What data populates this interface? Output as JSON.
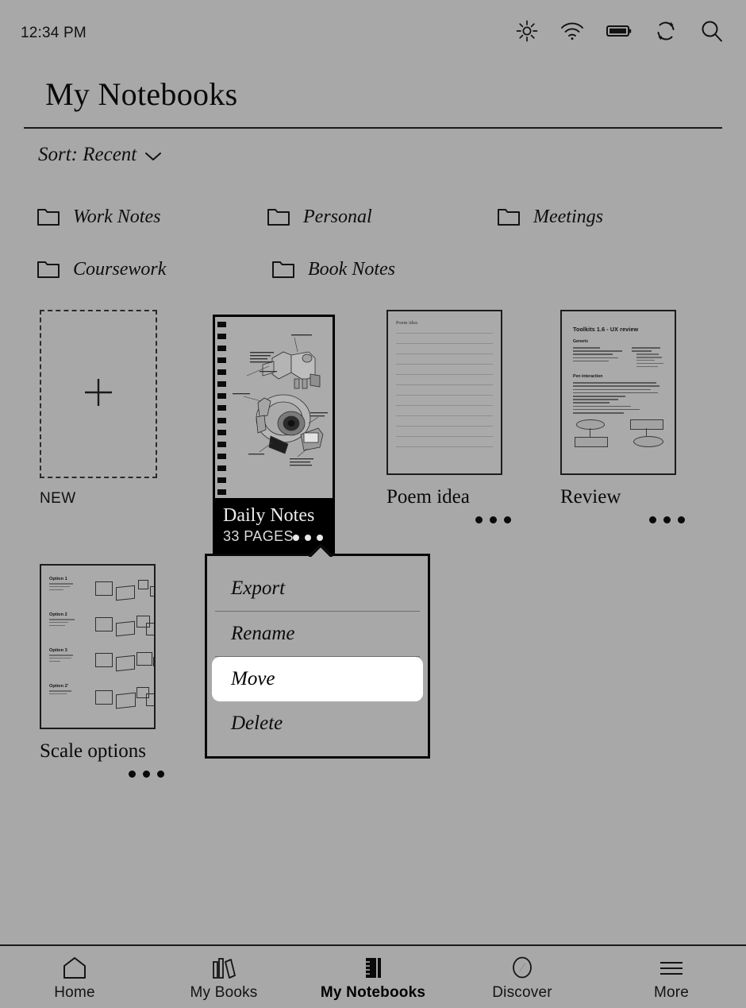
{
  "statusbar": {
    "time": "12:34 PM",
    "icons": [
      {
        "name": "brightness-icon",
        "label": "brightness"
      },
      {
        "name": "wifi-icon",
        "label": "wifi"
      },
      {
        "name": "battery-icon",
        "label": "battery-full"
      },
      {
        "name": "refresh-icon",
        "label": "refresh"
      },
      {
        "name": "search-icon",
        "label": "search"
      }
    ]
  },
  "header": {
    "title": "My Notebooks"
  },
  "sort": {
    "label": "Sort: Recent",
    "chevron": "chevron-down-icon"
  },
  "folders": [
    {
      "label": "Work Notes"
    },
    {
      "label": "Personal"
    },
    {
      "label": "Meetings"
    },
    {
      "label": "Coursework"
    },
    {
      "label": "Book Notes"
    }
  ],
  "new_tile": {
    "label": "NEW",
    "icon": "plus-icon"
  },
  "notebooks": [
    {
      "title": "Daily Notes",
      "pages": "33 PAGES",
      "selected": true,
      "thumbnail_kind": "sketch",
      "thumbnail_text": ""
    },
    {
      "title": "Poem idea",
      "pages": "",
      "selected": false,
      "thumbnail_kind": "lined",
      "thumbnail_text": "Poem idea"
    },
    {
      "title": "Review",
      "pages": "",
      "selected": false,
      "thumbnail_kind": "document",
      "thumbnail_text": "Toolkits 1.6 - UX review",
      "thumbnail_sections": [
        "Generic",
        "Pen interaction"
      ]
    },
    {
      "title": "Scale options",
      "pages": "",
      "selected": false,
      "thumbnail_kind": "scale",
      "thumbnail_options": [
        "Option 1",
        "Option 2",
        "Option 3",
        "Option 2'"
      ]
    }
  ],
  "context_menu": {
    "items": [
      {
        "label": "Export",
        "active": false
      },
      {
        "label": "Rename",
        "active": false
      },
      {
        "label": "Move",
        "active": true
      },
      {
        "label": "Delete",
        "active": false
      }
    ]
  },
  "nav": [
    {
      "label": "Home",
      "icon": "home-icon",
      "active": false
    },
    {
      "label": "My Books",
      "icon": "books-icon",
      "active": false
    },
    {
      "label": "My Notebooks",
      "icon": "notebook-icon",
      "active": true
    },
    {
      "label": "Discover",
      "icon": "compass-icon",
      "active": false
    },
    {
      "label": "More",
      "icon": "hamburger-icon",
      "active": false
    }
  ],
  "colors": {
    "background": "#a8a8a8",
    "ink": "#0a0a0a",
    "selected_card": "#000000",
    "highlight": "#ffffff"
  }
}
